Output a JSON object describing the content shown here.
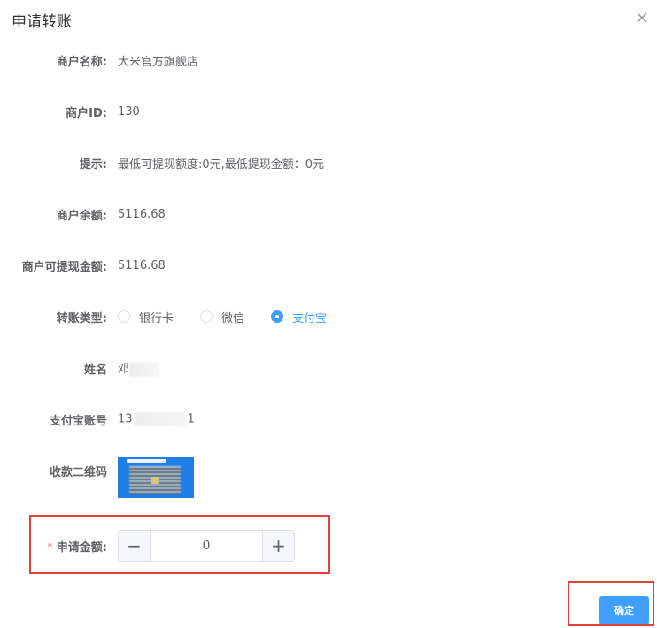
{
  "dialog": {
    "title": "申请转账",
    "close_icon": "close-icon"
  },
  "fields": {
    "merchant_name": {
      "label": "商户名称:",
      "value": "大米官方旗舰店"
    },
    "merchant_id": {
      "label": "商户ID:",
      "value": "130"
    },
    "tip": {
      "label": "提示:",
      "value": "最低可提现额度:0元,最低提现金额：0元"
    },
    "balance": {
      "label": "商户余额:",
      "value": "5116.68"
    },
    "withdrawable": {
      "label": "商户可提现金额:",
      "value": "5116.68"
    },
    "transfer_type": {
      "label": "转账类型:",
      "options": [
        "银行卡",
        "微信",
        "支付宝"
      ],
      "selected": "支付宝"
    },
    "name": {
      "label": "姓名",
      "value": "邓"
    },
    "alipay_account": {
      "label": "支付宝账号",
      "value_start": "13",
      "value_end": "1"
    },
    "qr_code": {
      "label": "收款二维码"
    },
    "amount": {
      "required_mark": "*",
      "label": "申请金额:",
      "value": "0",
      "minus": "−",
      "plus": "+"
    }
  },
  "footer": {
    "confirm_label": "确定"
  },
  "colors": {
    "primary": "#409eff",
    "highlight": "#e0423c",
    "required": "#f56c6c"
  }
}
